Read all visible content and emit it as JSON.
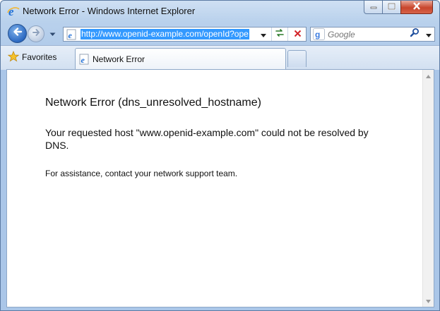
{
  "window": {
    "title": "Network Error - Windows Internet Explorer",
    "icon": "ie-icon",
    "controls": [
      "minimize-icon",
      "maximize-icon",
      "close-icon"
    ]
  },
  "nav": {
    "back": "back-arrow-icon",
    "forward": "forward-arrow-icon",
    "recent_pages": "chevron-down-icon"
  },
  "address": {
    "url": "http://www.openid-example.com/openId?ope",
    "page_icon": "ie-page-icon",
    "refresh": "refresh-icon",
    "stop": "stop-icon"
  },
  "search": {
    "placeholder": "Google",
    "provider_icon": "google-icon",
    "search_icon": "magnifier-icon"
  },
  "favorites": {
    "label": "Favorites",
    "icon": "star-icon"
  },
  "tabs": [
    {
      "label": "Network Error",
      "icon": "ie-page-icon"
    }
  ],
  "page": {
    "heading": "Network Error (dns_unresolved_hostname)",
    "message": "Your requested host \"www.openid-example.com\" could not be resolved by DNS.",
    "assistance": "For assistance, contact your network support team."
  },
  "colors": {
    "frame": "#b9d1ec",
    "selection": "#3399ff",
    "close_button": "#c8452c"
  }
}
